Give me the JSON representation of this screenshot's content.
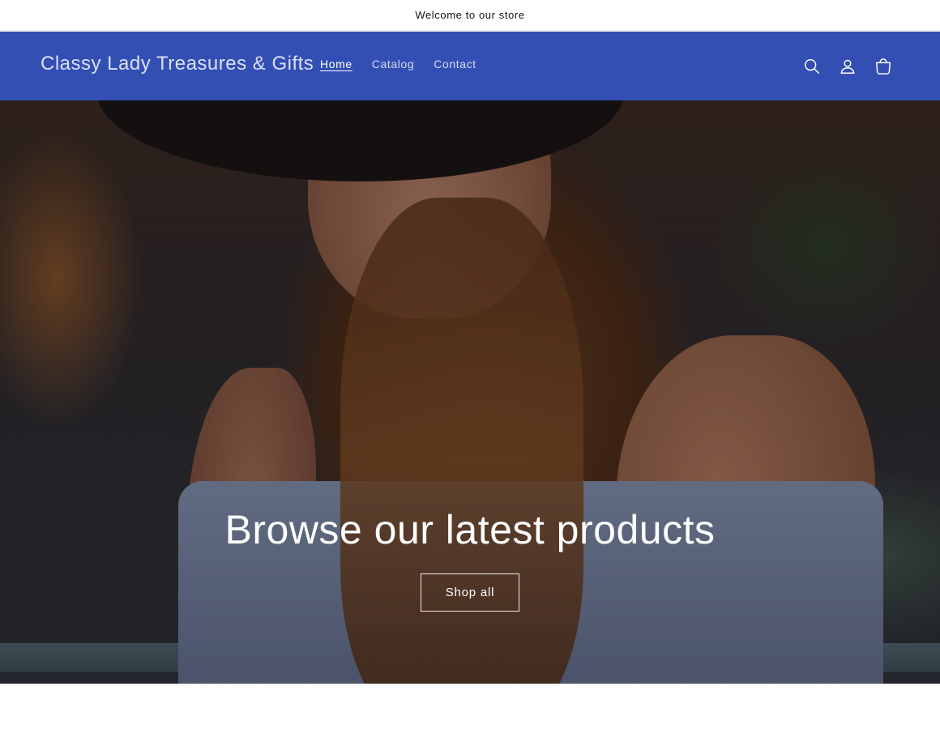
{
  "announcement": {
    "text": "Welcome to our store"
  },
  "header": {
    "logo": "Classy Lady Treasures & Gifts",
    "nav": [
      {
        "label": "Home",
        "active": true
      },
      {
        "label": "Catalog",
        "active": false
      },
      {
        "label": "Contact",
        "active": false
      }
    ],
    "icons": [
      "search-icon",
      "account-icon",
      "cart-icon"
    ],
    "background_color": "#334fb4"
  },
  "hero": {
    "heading": "Browse our latest products",
    "button_label": "Shop all"
  }
}
